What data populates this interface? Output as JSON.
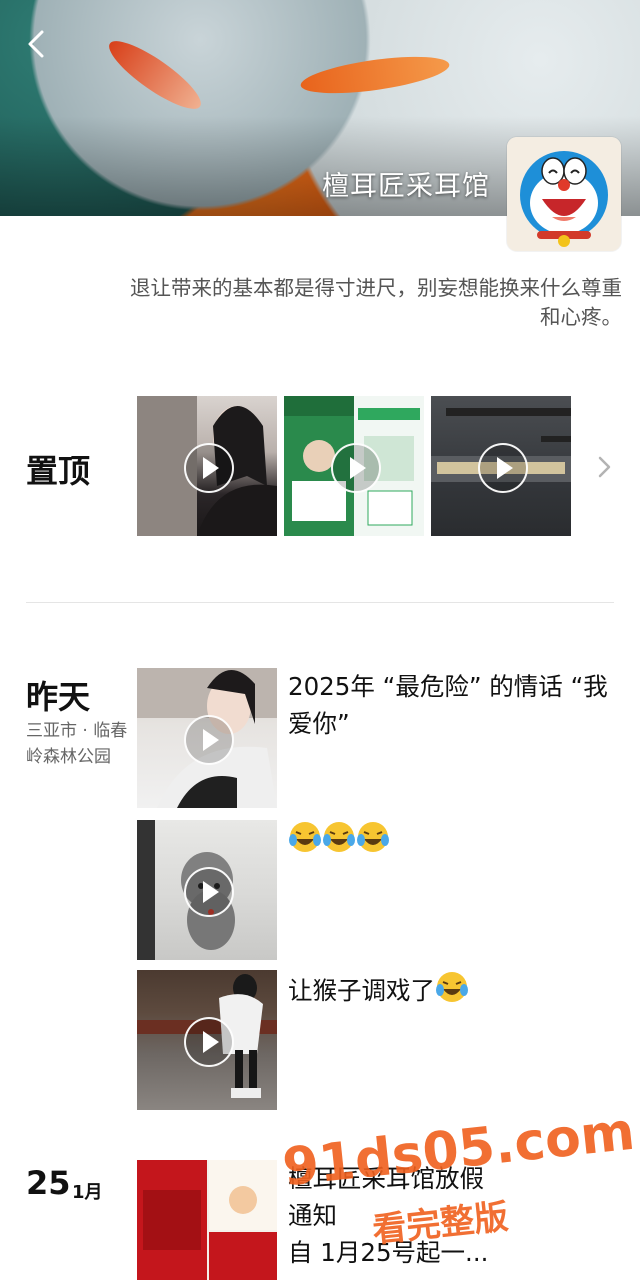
{
  "profile": {
    "name": "檀耳匠采耳馆",
    "signature_line1": "退让带来的基本都是得寸进尺，别妄想能换来什么尊重",
    "signature_line2": "和心疼。"
  },
  "pinned": {
    "title": "置顶"
  },
  "posts": [
    {
      "day": "昨天",
      "location": "三亚市 · 临春岭森林公园",
      "text": "2025年 “最危险” 的情话 “我爱你”"
    },
    {
      "text": ""
    },
    {
      "text": "让猴子调戏了"
    },
    {
      "date_num": "25",
      "date_month": "1月",
      "text_line1": "檀耳匠采耳馆放假",
      "text_line2": "通知",
      "text_line3": "自 1月25号起一..."
    }
  ],
  "watermark": {
    "line1": "91ds05.com",
    "line2": "看完整版"
  },
  "icons": {
    "back": "chevron-left-icon",
    "more": "chevron-right-icon",
    "play": "play-icon",
    "emoji": "laugh-cry-emoji-icon"
  },
  "colors": {
    "watermark": "#f0601e",
    "divider": "#e5e5e5"
  }
}
